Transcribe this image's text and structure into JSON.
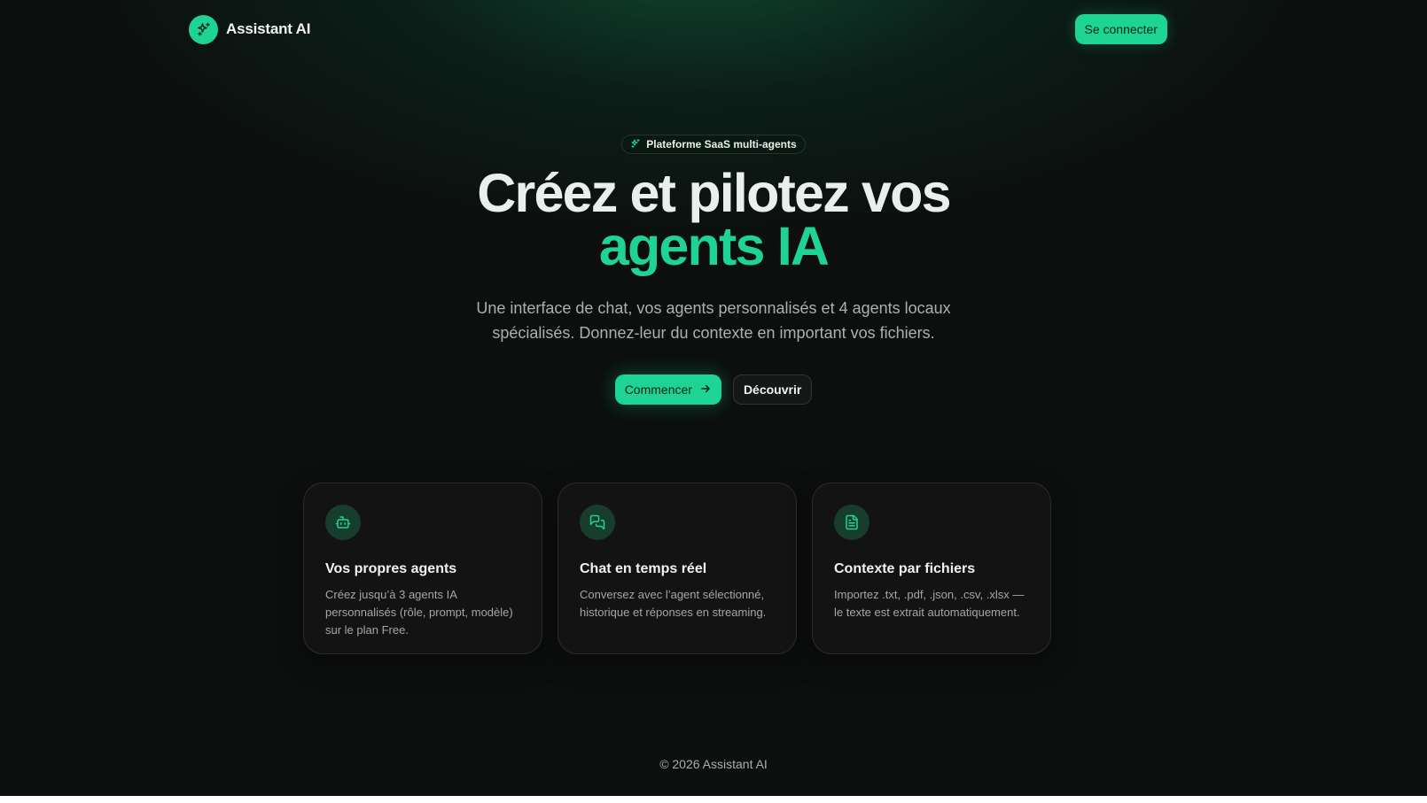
{
  "header": {
    "brand_name": "Assistant AI",
    "login_label": "Se connecter"
  },
  "hero": {
    "badge": "Plateforme SaaS multi-agents",
    "title_line1": "Créez et pilotez vos",
    "title_line2": "agents IA",
    "subtitle": "Une interface de chat, vos agents personnalisés et 4 agents locaux spécialisés. Donnez-leur du contexte en important vos fichiers.",
    "primary_cta": "Commencer",
    "secondary_cta": "Découvrir"
  },
  "features": [
    {
      "icon": "bot-icon",
      "title": "Vos propres agents",
      "text": "Créez jusqu’à 3 agents IA personnalisés (rôle, prompt, modèle) sur le plan Free."
    },
    {
      "icon": "chat-icon",
      "title": "Chat en temps réel",
      "text": "Conversez avec l’agent sélectionné, historique et réponses en streaming."
    },
    {
      "icon": "file-icon",
      "title": "Contexte par fichiers",
      "text": "Importez .txt, .pdf, .json, .csv, .xlsx — le texte est extrait automatiquement."
    }
  ],
  "footer": {
    "copyright": "© 2026 Assistant AI"
  },
  "colors": {
    "accent": "#1ed494",
    "background": "#0c0f0e",
    "card": "#141313"
  }
}
